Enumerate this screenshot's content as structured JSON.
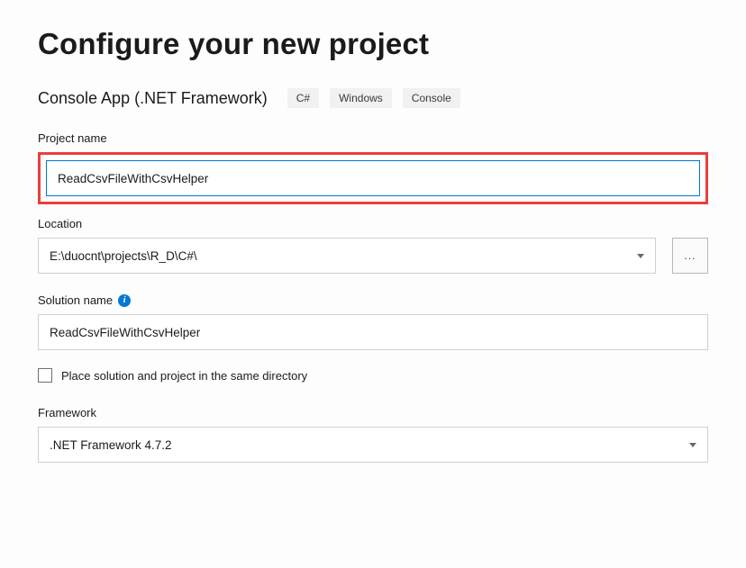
{
  "title": "Configure your new project",
  "template": {
    "name": "Console App (.NET Framework)",
    "tags": [
      "C#",
      "Windows",
      "Console"
    ]
  },
  "projectName": {
    "label": "Project name",
    "value": "ReadCsvFileWithCsvHelper"
  },
  "location": {
    "label": "Location",
    "value": "E:\\duocnt\\projects\\R_D\\C#\\",
    "browse": "..."
  },
  "solutionName": {
    "label": "Solution name",
    "value": "ReadCsvFileWithCsvHelper"
  },
  "sameDirectory": {
    "label": "Place solution and project in the same directory",
    "checked": false
  },
  "framework": {
    "label": "Framework",
    "value": ".NET Framework 4.7.2"
  }
}
